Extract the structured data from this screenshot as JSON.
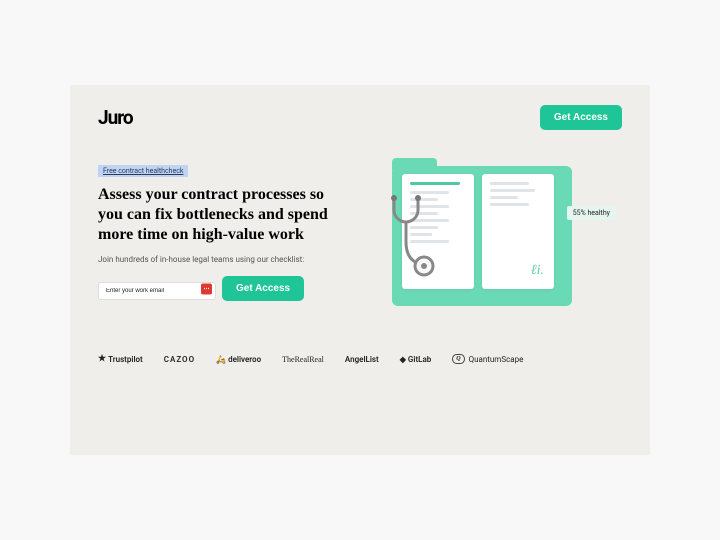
{
  "header": {
    "logo": "Juro",
    "cta": "Get Access"
  },
  "hero": {
    "badge": "Free contract healthcheck",
    "headline": "Assess your contract processes so you can fix bottlenecks and spend more time on high-value work",
    "subheading": "Join hundreds of in-house legal teams using our checklist:",
    "email_placeholder": "Enter your work email",
    "submit": "Get Access"
  },
  "illustration": {
    "health_label": "55% healthy"
  },
  "logos": [
    "Trustpilot",
    "CAZOO",
    "deliveroo",
    "TheRealReal",
    "AngelList",
    "GitLab",
    "QuantumScape"
  ]
}
